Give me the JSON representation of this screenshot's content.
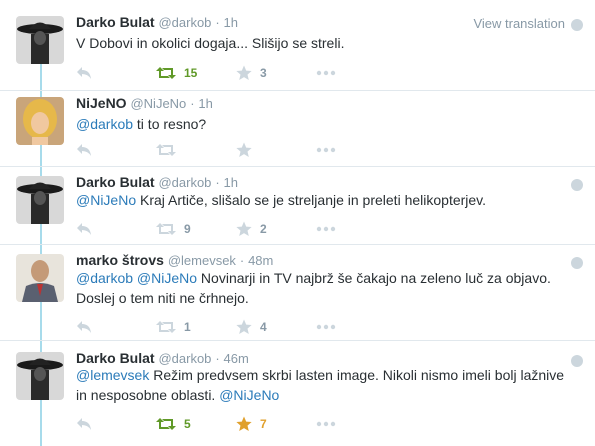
{
  "view_translation": "View translation",
  "tweets": [
    {
      "name": "Darko Bulat",
      "handle": "@darkob",
      "dot": "·",
      "time": "1h",
      "text": [
        {
          "t": "V Dobovi in okolici dogaja... Slišijo se streli."
        }
      ],
      "retweets": "15",
      "favorites": "3"
    },
    {
      "name": "NiJeNO",
      "handle": "@NiJeNo",
      "dot": "·",
      "time": "1h",
      "text": [
        {
          "t": "@darkob",
          "m": true
        },
        {
          "t": " ti to resno?"
        }
      ],
      "retweets": "",
      "favorites": ""
    },
    {
      "name": "Darko Bulat",
      "handle": "@darkob",
      "dot": "·",
      "time": "1h",
      "text": [
        {
          "t": "@NiJeNo",
          "m": true
        },
        {
          "t": " Kraj Artiče, slišalo se je streljanje in preleti helikopterjev."
        }
      ],
      "retweets": "9",
      "favorites": "2"
    },
    {
      "name": "marko štrovs",
      "handle": "@lemevsek",
      "dot": "·",
      "time": "48m",
      "text": [
        {
          "t": "@darkob",
          "m": true
        },
        {
          "t": " "
        },
        {
          "t": "@NiJeNo",
          "m": true
        },
        {
          "t": " Novinarji in TV najbrž še čakajo na zeleno luč za objavo. Doslej o tem niti ne črhnejo."
        }
      ],
      "retweets": "1",
      "favorites": "4"
    },
    {
      "name": "Darko Bulat",
      "handle": "@darkob",
      "dot": "·",
      "time": "46m",
      "text": [
        {
          "t": "@lemevsek",
          "m": true
        },
        {
          "t": " Režim predvsem skrbi lasten image. Nikoli nismo imeli bolj lažnive in nesposobne oblasti. "
        },
        {
          "t": "@NiJeNo",
          "m": true
        }
      ],
      "retweets": "5",
      "favorites": "7"
    }
  ]
}
